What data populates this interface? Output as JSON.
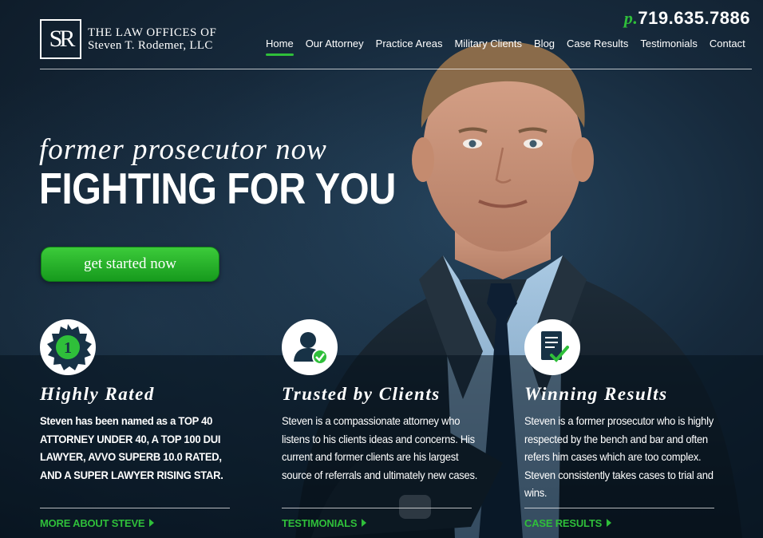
{
  "brand": {
    "logo_mark": "SR",
    "line1": "THE LAW OFFICES OF",
    "line2": "Steven T. Rodemer, LLC"
  },
  "phone": {
    "prefix": "p.",
    "number": "719.635.7886"
  },
  "nav": {
    "items": [
      {
        "label": "Home"
      },
      {
        "label": "Our Attorney"
      },
      {
        "label": "Practice Areas"
      },
      {
        "label": "Military Clients"
      },
      {
        "label": "Blog"
      },
      {
        "label": "Case Results"
      },
      {
        "label": "Testimonials"
      },
      {
        "label": "Contact"
      }
    ],
    "active": "Home"
  },
  "hero": {
    "tagline": "former prosecutor now",
    "headline": "FIGHTING FOR YOU",
    "cta_label": "get started now"
  },
  "features": [
    {
      "icon": "award-badge-icon",
      "badge_number": "1",
      "title": "Highly Rated",
      "text": "Steven has been named as a TOP 40 ATTORNEY UNDER 40, A TOP 100 DUI LAWYER, AVVO SUPERB 10.0 RATED, AND A SUPER LAWYER RISING STAR.",
      "link_label": "MORE ABOUT STEVE"
    },
    {
      "icon": "trusted-client-icon",
      "title": "Trusted by Clients",
      "text": "Steven is a compassionate attorney who listens to his clients ideas and concerns. His current and former clients are his largest source of referrals and ultimately new cases.",
      "link_label": "TESTIMONIALS"
    },
    {
      "icon": "document-check-icon",
      "title": "Winning Results",
      "text": "Steven is a former prosecutor who is highly respected by the bench and bar and often refers him cases which are too complex. Steven consistently takes cases to trial and wins.",
      "link_label": "CASE RESULTS"
    }
  ],
  "colors": {
    "accent": "#2fbf3a",
    "background": "#16293b",
    "text": "#ffffff"
  }
}
